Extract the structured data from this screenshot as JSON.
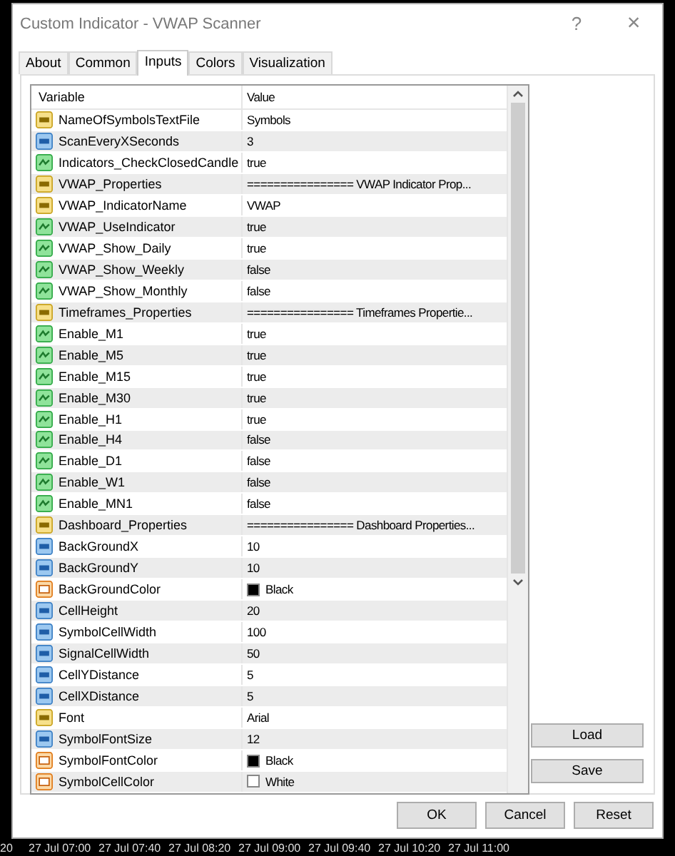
{
  "window": {
    "title": "Custom Indicator - VWAP Scanner",
    "help": "?",
    "close": "×"
  },
  "tabs": [
    {
      "label": "About",
      "selected": false
    },
    {
      "label": "Common",
      "selected": false
    },
    {
      "label": "Inputs",
      "selected": true
    },
    {
      "label": "Colors",
      "selected": false
    },
    {
      "label": "Visualization",
      "selected": false
    }
  ],
  "table": {
    "columns": [
      "Variable",
      "Value"
    ],
    "rows": [
      {
        "kind": "string",
        "variable": "NameOfSymbolsTextFile",
        "value": "Symbols"
      },
      {
        "kind": "int",
        "variable": "ScanEveryXSeconds",
        "value": "3"
      },
      {
        "kind": "bool",
        "variable": "Indicators_CheckClosedCandle",
        "value": "true"
      },
      {
        "kind": "string",
        "variable": "VWAP_Properties",
        "value": "================ VWAP Indicator Prop..."
      },
      {
        "kind": "string",
        "variable": "VWAP_IndicatorName",
        "value": "VWAP"
      },
      {
        "kind": "bool",
        "variable": "VWAP_UseIndicator",
        "value": "true"
      },
      {
        "kind": "bool",
        "variable": "VWAP_Show_Daily",
        "value": "true"
      },
      {
        "kind": "bool",
        "variable": "VWAP_Show_Weekly",
        "value": "false"
      },
      {
        "kind": "bool",
        "variable": "VWAP_Show_Monthly",
        "value": "false"
      },
      {
        "kind": "string",
        "variable": "Timeframes_Properties",
        "value": "================ Timeframes Propertie..."
      },
      {
        "kind": "bool",
        "variable": "Enable_M1",
        "value": "true"
      },
      {
        "kind": "bool",
        "variable": "Enable_M5",
        "value": "true"
      },
      {
        "kind": "bool",
        "variable": "Enable_M15",
        "value": "true"
      },
      {
        "kind": "bool",
        "variable": "Enable_M30",
        "value": "true"
      },
      {
        "kind": "bool",
        "variable": "Enable_H1",
        "value": "true"
      },
      {
        "kind": "bool",
        "variable": "Enable_H4",
        "value": "false"
      },
      {
        "kind": "bool",
        "variable": "Enable_D1",
        "value": "false"
      },
      {
        "kind": "bool",
        "variable": "Enable_W1",
        "value": "false"
      },
      {
        "kind": "bool",
        "variable": "Enable_MN1",
        "value": "false"
      },
      {
        "kind": "string",
        "variable": "Dashboard_Properties",
        "value": "================ Dashboard Properties..."
      },
      {
        "kind": "int",
        "variable": "BackGroundX",
        "value": "10"
      },
      {
        "kind": "int",
        "variable": "BackGroundY",
        "value": "10"
      },
      {
        "kind": "color",
        "variable": "BackGroundColor",
        "value": "Black",
        "color": "#000000"
      },
      {
        "kind": "int",
        "variable": "CellHeight",
        "value": "20"
      },
      {
        "kind": "int",
        "variable": "SymbolCellWidth",
        "value": "100"
      },
      {
        "kind": "int",
        "variable": "SignalCellWidth",
        "value": "50"
      },
      {
        "kind": "int",
        "variable": "CellYDistance",
        "value": "5"
      },
      {
        "kind": "int",
        "variable": "CellXDistance",
        "value": "5"
      },
      {
        "kind": "string",
        "variable": "Font",
        "value": "Arial"
      },
      {
        "kind": "int",
        "variable": "SymbolFontSize",
        "value": "12"
      },
      {
        "kind": "color",
        "variable": "SymbolFontColor",
        "value": "Black",
        "color": "#000000"
      },
      {
        "kind": "color",
        "variable": "SymbolCellColor",
        "value": "White",
        "color": "#ffffff"
      }
    ]
  },
  "side_buttons": [
    "Load",
    "Save"
  ],
  "buttons": [
    "OK",
    "Cancel",
    "Reset"
  ],
  "chart_time_axis": [
    "20",
    "27 Jul 07:00",
    "27 Jul 07:40",
    "27 Jul 08:20",
    "27 Jul 09:00",
    "27 Jul 09:40",
    "27 Jul 10:20",
    "27 Jul 11:00"
  ]
}
